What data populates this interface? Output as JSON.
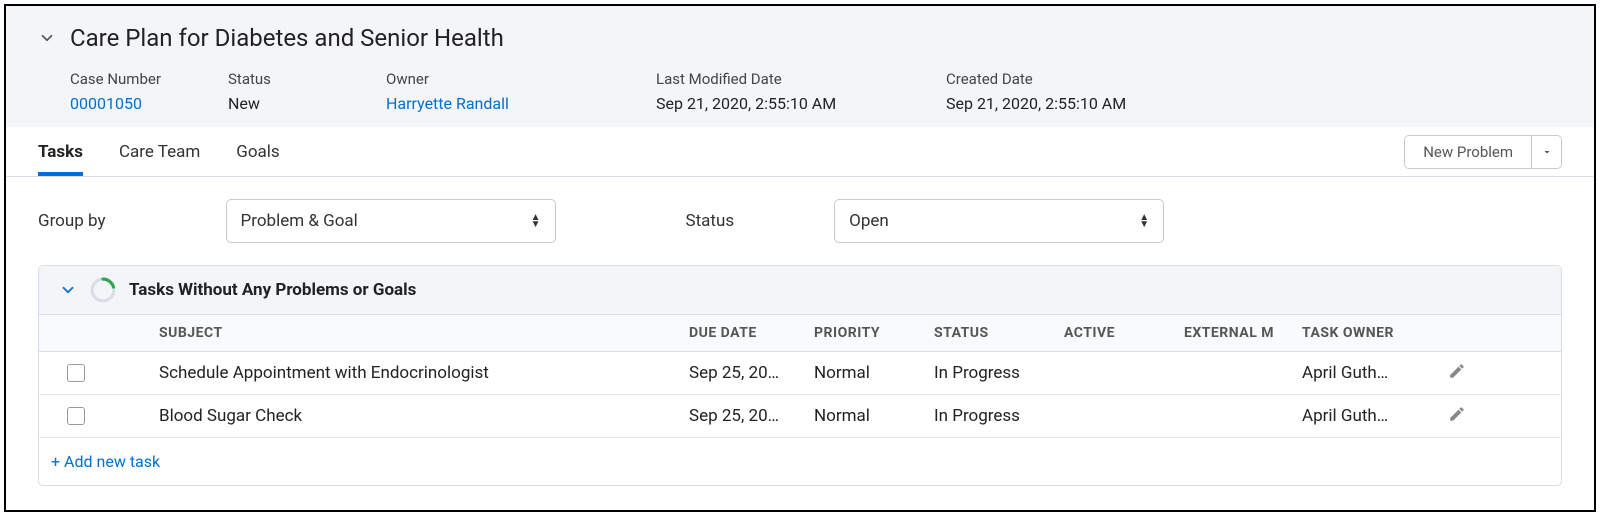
{
  "header": {
    "title": "Care Plan for Diabetes and Senior Health",
    "caseNumber": {
      "label": "Case Number",
      "value": "00001050"
    },
    "status": {
      "label": "Status",
      "value": "New"
    },
    "owner": {
      "label": "Owner",
      "value": "Harryette Randall"
    },
    "lastModified": {
      "label": "Last Modified Date",
      "value": "Sep 21, 2020, 2:55:10 AM"
    },
    "created": {
      "label": "Created Date",
      "value": "Sep 21, 2020, 2:55:10 AM"
    }
  },
  "tabs": {
    "items": [
      {
        "label": "Tasks",
        "active": true
      },
      {
        "label": "Care Team",
        "active": false
      },
      {
        "label": "Goals",
        "active": false
      }
    ]
  },
  "buttons": {
    "newProblem": "New Problem"
  },
  "filters": {
    "groupByLabel": "Group by",
    "groupByValue": "Problem & Goal",
    "statusLabel": "Status",
    "statusValue": "Open"
  },
  "section": {
    "title": "Tasks Without Any Problems or Goals",
    "columns": {
      "subject": "Subject",
      "dueDate": "Due Date",
      "priority": "Priority",
      "status": "Status",
      "active": "Active",
      "external": "External M",
      "owner": "Task Owner"
    },
    "rows": [
      {
        "subject": "Schedule Appointment with Endocrinologist",
        "dueDate": "Sep 25, 20…",
        "priority": "Normal",
        "status": "In Progress",
        "active": "",
        "external": "",
        "owner": "April Guth…"
      },
      {
        "subject": "Blood Sugar Check",
        "dueDate": "Sep 25, 20…",
        "priority": "Normal",
        "status": "In Progress",
        "active": "",
        "external": "",
        "owner": "April Guth…"
      }
    ],
    "addLink": "+ Add new task"
  }
}
